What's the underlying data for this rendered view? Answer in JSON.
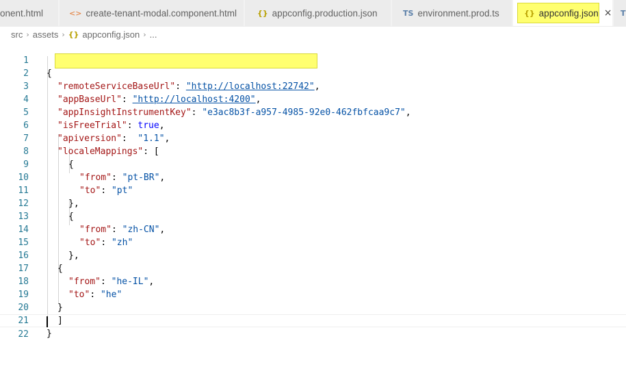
{
  "tabs": [
    {
      "icon": "html-icon",
      "glyph": "<>",
      "label": "onent.html",
      "active": false
    },
    {
      "icon": "html-icon",
      "glyph": "<>",
      "label": "create-tenant-modal.component.html",
      "active": false
    },
    {
      "icon": "json-icon",
      "glyph": "{}",
      "label": "appconfig.production.json",
      "active": false
    },
    {
      "icon": "ts-icon",
      "glyph": "TS",
      "label": "environment.prod.ts",
      "active": false
    },
    {
      "icon": "json-icon",
      "glyph": "{}",
      "label": "appconfig.json",
      "active": true,
      "close": "×"
    },
    {
      "icon": "ts-icon",
      "glyph": "TS",
      "label": "",
      "active": false
    }
  ],
  "breadcrumb": {
    "parts": [
      "src",
      "assets",
      "appconfig.json",
      "..."
    ],
    "sep": "›",
    "json_glyph": "{}"
  },
  "editor": {
    "line_numbers": [
      "1",
      "2",
      "3",
      "4",
      "5",
      "6",
      "7",
      "8",
      "9",
      "10",
      "11",
      "12",
      "13",
      "14",
      "15",
      "16",
      "17",
      "18",
      "19",
      "20",
      "21",
      "22"
    ],
    "content": {
      "l1": "{",
      "l2_key": "\"remoteServiceBaseUrl\"",
      "l2_val": "\"http://localhost:22742\"",
      "l3_key": "\"appBaseUrl\"",
      "l3_val": "\"http://localhost:4200\"",
      "l4_key": "\"appInsightInstrumentKey\"",
      "l4_val": "\"e3ac8b3f-a957-4985-92e0-462fbfcaa9c7\"",
      "l5_key": "\"isFreeTrial\"",
      "l5_val": "true",
      "l6_key": "\"apiversion\"",
      "l6_val": "\"1.1\"",
      "l7_key": "\"localeMappings\"",
      "l7_val": "[",
      "l8": "{",
      "l9_key": "\"from\"",
      "l9_val": "\"pt-BR\"",
      "l10_key": "\"to\"",
      "l10_val": "\"pt\"",
      "l11": "},",
      "l12": "{",
      "l13_key": "\"from\"",
      "l13_val": "\"zh-CN\"",
      "l14_key": "\"to\"",
      "l14_val": "\"zh\"",
      "l15": "},",
      "l16": "{",
      "l17_key": "\"from\"",
      "l17_val": "\"he-IL\"",
      "l18_key": "\"to\"",
      "l18_val": "\"he\"",
      "l19": "}",
      "l20": "]",
      "l21": "}",
      "l22": ""
    }
  }
}
